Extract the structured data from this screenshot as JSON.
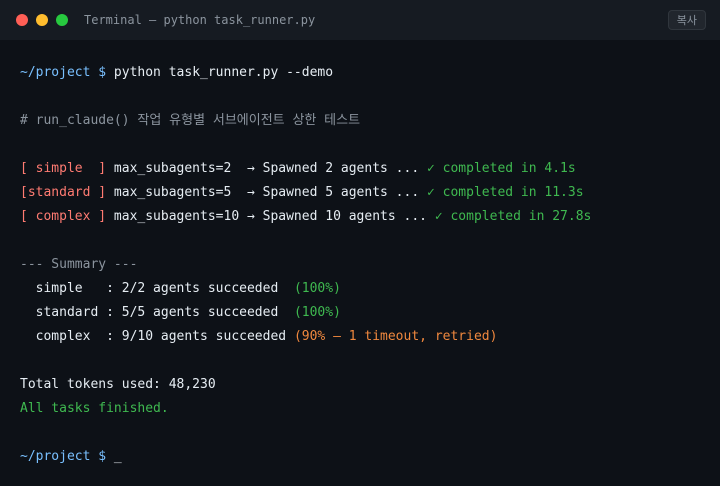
{
  "window": {
    "title": "Terminal — python task_runner.py",
    "copy_label": "복사"
  },
  "terminal": {
    "prompt": "~/project $ ",
    "command": "python task_runner.py --demo",
    "comment": "# run_claude() 작업 유형별 서브에이전트 상한 테스트",
    "runs": [
      {
        "tag": "[ simple  ]",
        "param": " max_subagents=2  → Spawned 2 agents ... ",
        "status": "✓ completed in 4.1s"
      },
      {
        "tag": "[standard ]",
        "param": " max_subagents=5  → Spawned 5 agents ... ",
        "status": "✓ completed in 11.3s"
      },
      {
        "tag": "[ complex ]",
        "param": " max_subagents=10 → Spawned 10 agents ... ",
        "status": "✓ completed in 27.8s"
      }
    ],
    "summary_header": "--- Summary ---",
    "summary": [
      {
        "label": "  simple   : 2/2 agents succeeded  ",
        "result": "(100%)",
        "status": "success"
      },
      {
        "label": "  standard : 5/5 agents succeeded  ",
        "result": "(100%)",
        "status": "success"
      },
      {
        "label": "  complex  : 9/10 agents succeeded ",
        "result": "(90% — 1 timeout, retried)",
        "status": "warning"
      }
    ],
    "total_tokens": "Total tokens used: 48,230",
    "finished": "All tasks finished.",
    "final_prompt": "~/project $ ",
    "cursor": "_"
  },
  "colors": {
    "background": "#0d1117",
    "prompt": "#79c0ff",
    "error_tag": "#ff7b72",
    "success": "#3fb950",
    "warning": "#f0883e",
    "comment": "#8b949e"
  }
}
